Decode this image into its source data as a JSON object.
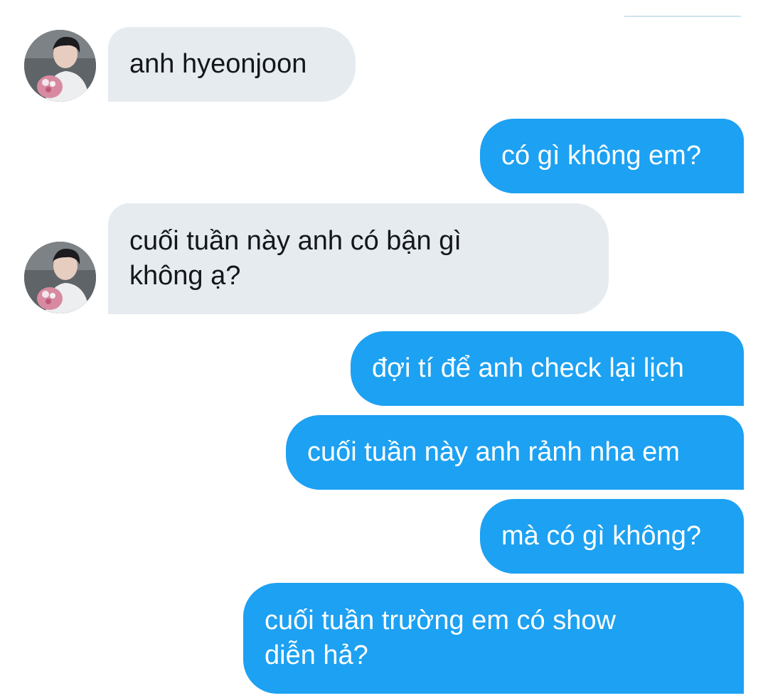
{
  "conversation": {
    "messages": [
      {
        "sender": "contact",
        "text": "anh hyeonjoon"
      },
      {
        "sender": "me",
        "text": "có gì không em?"
      },
      {
        "sender": "contact",
        "text": "cuối tuần này anh có bận gì\nkhông ạ?"
      },
      {
        "sender": "me",
        "text": "đợi tí để anh check lại lịch"
      },
      {
        "sender": "me",
        "text": "cuối tuần này anh rảnh nha em"
      },
      {
        "sender": "me",
        "text": "mà có gì không?"
      },
      {
        "sender": "me",
        "text": "cuối tuần trường em có show\ndiễn hả?"
      }
    ]
  },
  "colors": {
    "incoming_bubble": "#e6ebef",
    "outgoing_bubble": "#1da1f2",
    "incoming_text": "#14171a",
    "outgoing_text": "#ffffff"
  },
  "icons": {
    "contact_avatar": "avatar-photo"
  }
}
